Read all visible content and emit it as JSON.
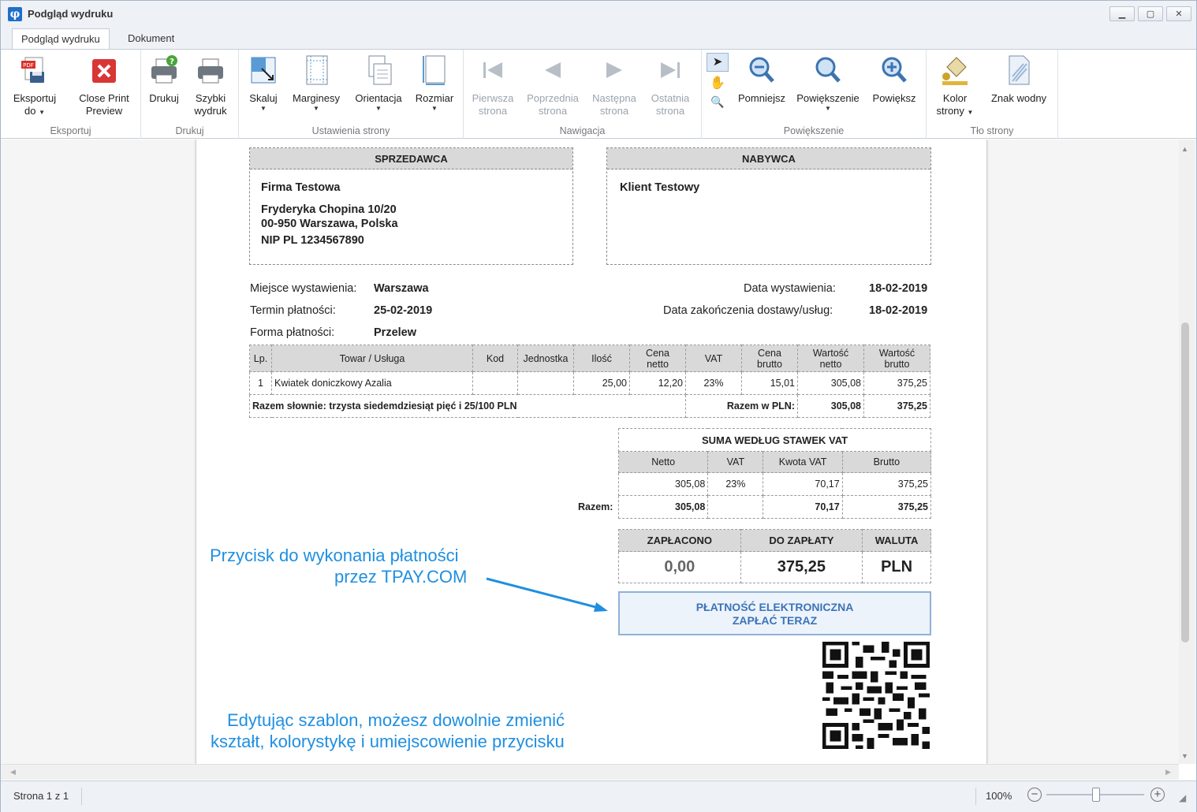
{
  "window": {
    "title": "Podgląd wydruku",
    "controls": [
      "▁",
      "▢",
      "✕"
    ]
  },
  "tabs": [
    "Podgląd wydruku",
    "Dokument"
  ],
  "ribbon": {
    "groups": {
      "eksport": "Eksportuj",
      "drukuj": "Drukuj",
      "ustawienia": "Ustawienia strony",
      "nawigacja": "Nawigacja",
      "powiekszenie": "Powiększenie",
      "tlo": "Tło strony"
    },
    "buttons": {
      "eksportuj_1": "Eksportuj",
      "eksportuj_2": "do",
      "close_1": "Close Print",
      "close_2": "Preview",
      "drukuj": "Drukuj",
      "szybki_1": "Szybki",
      "szybki_2": "wydruk",
      "skaluj": "Skaluj",
      "marginesy": "Marginesy",
      "orientacja": "Orientacja",
      "rozmiar": "Rozmiar",
      "pierwsza_1": "Pierwsza",
      "pierwsza_2": "strona",
      "poprzednia_1": "Poprzednia",
      "poprzednia_2": "strona",
      "nastepna_1": "Następna",
      "nastepna_2": "strona",
      "ostatnia_1": "Ostatnia",
      "ostatnia_2": "strona",
      "pomniejsz": "Pomniejsz",
      "powiekszenie": "Powiększenie",
      "powieksz": "Powiększ",
      "kolor_1": "Kolor",
      "kolor_2": "strony",
      "znak": "Znak wodny"
    }
  },
  "invoice": {
    "seller_header": "SPRZEDAWCA",
    "buyer_header": "NABYWCA",
    "seller": {
      "name": "Firma Testowa",
      "street": "Fryderyka Chopina 10/20",
      "city": "00-950 Warszawa, Polska",
      "nip": "NIP PL 1234567890"
    },
    "buyer": {
      "name": "Klient Testowy"
    },
    "meta": {
      "place_label": "Miejsce wystawienia:",
      "place": "Warszawa",
      "due_label": "Termin płatności:",
      "due": "25-02-2019",
      "form_label": "Forma płatności:",
      "form": "Przelew",
      "issue_label": "Data wystawienia:",
      "issue": "18-02-2019",
      "delivery_label": "Data zakończenia dostawy/usług:",
      "delivery": "18-02-2019"
    },
    "items_header": {
      "lp": "Lp.",
      "towar": "Towar / Usługa",
      "kod": "Kod",
      "jednostka": "Jednostka",
      "ilosc": "Ilość",
      "cena_netto_1": "Cena",
      "cena_netto_2": "netto",
      "vat": "VAT",
      "cena_brutto_1": "Cena",
      "cena_brutto_2": "brutto",
      "wartosc_netto_1": "Wartość",
      "wartosc_netto_2": "netto",
      "wartosc_brutto_1": "Wartość",
      "wartosc_brutto_2": "brutto"
    },
    "items": [
      {
        "lp": "1",
        "towar": "Kwiatek doniczkowy Azalia",
        "kod": "",
        "jednostka": "",
        "ilosc": "25,00",
        "cena_netto": "12,20",
        "vat": "23%",
        "cena_brutto": "15,01",
        "wartosc_netto": "305,08",
        "wartosc_brutto": "375,25"
      }
    ],
    "words_total": "Razem słownie: trzysta siedemdziesiąt pięć i 25/100 PLN",
    "total_label": "Razem w PLN:",
    "total_netto": "305,08",
    "total_brutto": "375,25",
    "vat_summary": {
      "title": "SUMA WEDŁUG STAWEK VAT",
      "cols": [
        "Netto",
        "VAT",
        "Kwota VAT",
        "Brutto"
      ],
      "row": [
        "305,08",
        "23%",
        "70,17",
        "375,25"
      ],
      "total_label": "Razem:",
      "total": [
        "305,08",
        "",
        "70,17",
        "375,25"
      ]
    },
    "payment": {
      "paid_label": "ZAPŁACONO",
      "due_label": "DO ZAPŁATY",
      "currency_label": "WALUTA",
      "paid": "0,00",
      "due": "375,25",
      "currency": "PLN"
    },
    "pay_button_1": "PŁATNOŚĆ ELEKTRONICZNA",
    "pay_button_2": "ZAPŁAĆ TERAZ"
  },
  "annotations": {
    "note1_line1": "Przycisk do wykonania płatności",
    "note1_line2": "przez TPAY.COM",
    "note2_line1": "Edytując szablon, możesz dowolnie zmienić",
    "note2_line2": "kształt, kolorystykę i umiejscowienie przycisku"
  },
  "status": {
    "page": "Strona 1 z 1",
    "zoom": "100%",
    "zoom_level": 1.0
  },
  "colors": {
    "accent": "#1f8fe0",
    "pay_button_text": "#3b74b8",
    "header_bg": "#d9d9d9"
  }
}
